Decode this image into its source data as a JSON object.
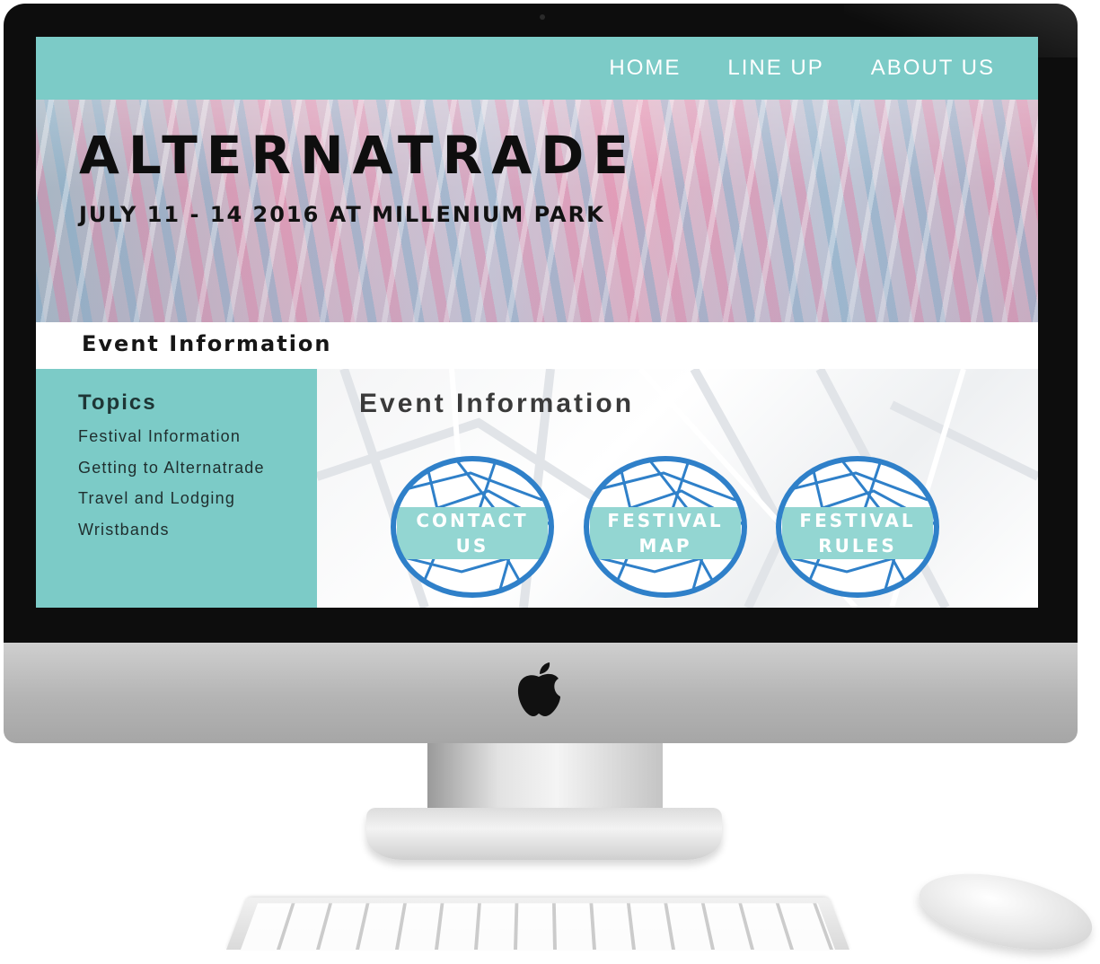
{
  "nav": {
    "items": [
      "HOME",
      "LINE UP",
      "ABOUT US"
    ]
  },
  "hero": {
    "title": "ALTERNATRADE",
    "subtitle": "JULY 11 - 14 2016 AT MILLENIUM PARK"
  },
  "section_title": "Event Information",
  "sidebar": {
    "title": "Topics",
    "items": [
      "Festival Information",
      "Getting to Alternatrade",
      "Travel and Lodging",
      "Wristbands"
    ]
  },
  "main": {
    "title": "Event Information",
    "badges": [
      {
        "line1": "CONTACT",
        "line2": "US"
      },
      {
        "line1": "FESTIVAL",
        "line2": "MAP"
      },
      {
        "line1": "FESTIVAL",
        "line2": "RULES"
      }
    ]
  },
  "colors": {
    "accent": "#7ccbc7",
    "badge_ring": "#2f80c9",
    "badge_band": "#93d6d2"
  },
  "icons": {
    "hardware_logo": "apple-icon"
  }
}
